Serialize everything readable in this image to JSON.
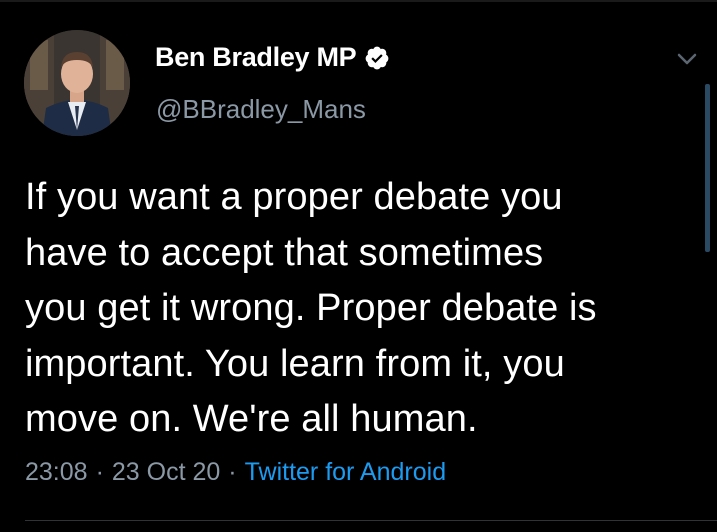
{
  "author": {
    "display_name": "Ben Bradley MP",
    "handle": "@BBradley_Mans",
    "verified": true,
    "avatar": "profile-photo"
  },
  "tweet": {
    "text": "If you want a proper debate you\nhave to accept that sometimes\nyou get it wrong. Proper debate is\nimportant. You learn from it, you\nmove on. We're all human.",
    "time": "23:08",
    "date": "23 Oct 20",
    "separator": "·",
    "source": "Twitter for Android"
  },
  "icons": {
    "verified": "verified-badge-icon",
    "menu": "chevron-down-icon"
  },
  "colors": {
    "background": "#000000",
    "text": "#ffffff",
    "secondary_text": "#8b98a5",
    "link": "#1d9bf0"
  }
}
